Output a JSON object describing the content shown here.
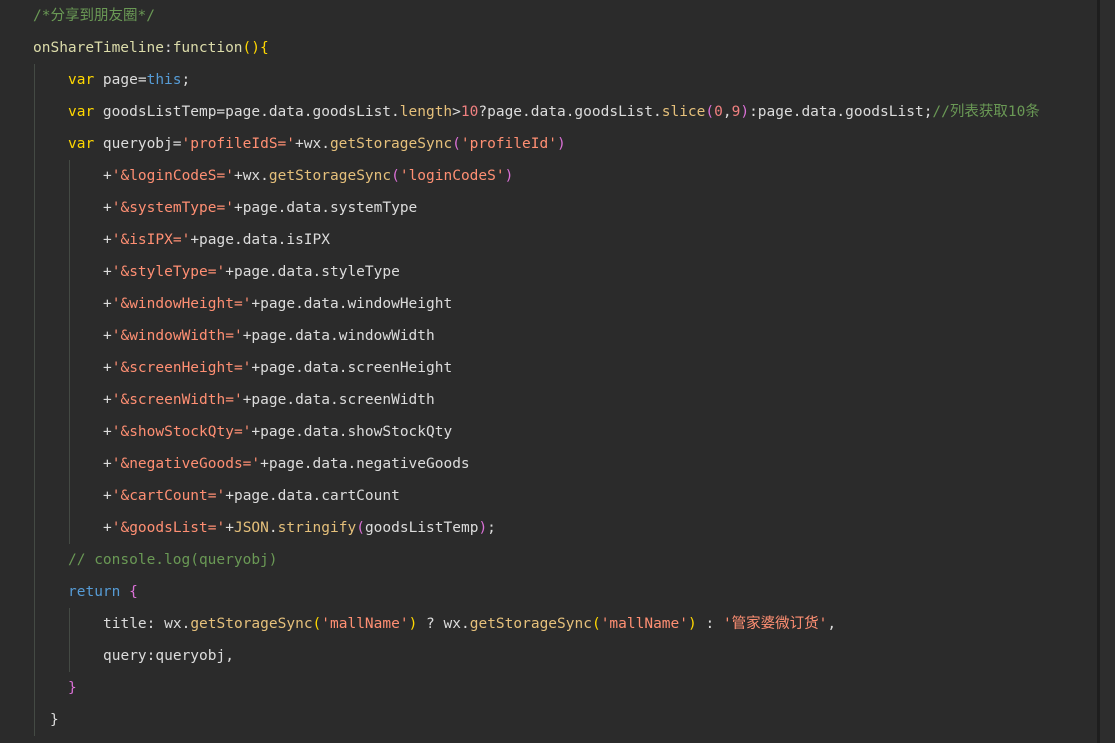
{
  "colors": {
    "background": "#2b2b2b",
    "comment": "#6a9955",
    "keyword": "#ffd700",
    "string": "#ff8f73",
    "number": "#f08080",
    "method": "#e5c07b",
    "text": "#dcdcdc"
  },
  "code": {
    "lines": [
      {
        "tokens": [
          {
            "t": "/*分享到朋友圈*/",
            "c": "cm"
          }
        ]
      },
      {
        "tokens": [
          {
            "t": "onShareTimeline",
            "c": "fn"
          },
          {
            "t": ":",
            "c": "op"
          },
          {
            "t": "function",
            "c": "fn"
          },
          {
            "t": "(",
            "c": "p1"
          },
          {
            "t": ")",
            "c": "p1"
          },
          {
            "t": "{",
            "c": "p1"
          }
        ]
      },
      {
        "tokens": [
          {
            "t": "var",
            "c": "kw"
          },
          {
            "t": " page",
            "c": "id"
          },
          {
            "t": "=",
            "c": "op"
          },
          {
            "t": "this",
            "c": "kw2"
          },
          {
            "t": ";",
            "c": "op"
          }
        ]
      },
      {
        "tokens": [
          {
            "t": "var",
            "c": "kw"
          },
          {
            "t": " goodsListTemp",
            "c": "id"
          },
          {
            "t": "=",
            "c": "op"
          },
          {
            "t": "page",
            "c": "id"
          },
          {
            "t": ".",
            "c": "op"
          },
          {
            "t": "data",
            "c": "prop"
          },
          {
            "t": ".",
            "c": "op"
          },
          {
            "t": "goodsList",
            "c": "prop"
          },
          {
            "t": ".",
            "c": "op"
          },
          {
            "t": "length",
            "c": "meth"
          },
          {
            "t": ">",
            "c": "op"
          },
          {
            "t": "10",
            "c": "num"
          },
          {
            "t": "?",
            "c": "op"
          },
          {
            "t": "page",
            "c": "id"
          },
          {
            "t": ".",
            "c": "op"
          },
          {
            "t": "data",
            "c": "prop"
          },
          {
            "t": ".",
            "c": "op"
          },
          {
            "t": "goodsList",
            "c": "prop"
          },
          {
            "t": ".",
            "c": "op"
          },
          {
            "t": "slice",
            "c": "meth"
          },
          {
            "t": "(",
            "c": "p2"
          },
          {
            "t": "0",
            "c": "num"
          },
          {
            "t": ",",
            "c": "op"
          },
          {
            "t": "9",
            "c": "num"
          },
          {
            "t": ")",
            "c": "p2"
          },
          {
            "t": ":",
            "c": "op"
          },
          {
            "t": "page",
            "c": "id"
          },
          {
            "t": ".",
            "c": "op"
          },
          {
            "t": "data",
            "c": "prop"
          },
          {
            "t": ".",
            "c": "op"
          },
          {
            "t": "goodsList",
            "c": "prop"
          },
          {
            "t": ";",
            "c": "op"
          },
          {
            "t": "//列表获取10条",
            "c": "cm"
          }
        ]
      },
      {
        "tokens": [
          {
            "t": "var",
            "c": "kw"
          },
          {
            "t": " queryobj",
            "c": "id"
          },
          {
            "t": "=",
            "c": "op"
          },
          {
            "t": "'profileIdS='",
            "c": "str"
          },
          {
            "t": "+",
            "c": "op"
          },
          {
            "t": "wx",
            "c": "id"
          },
          {
            "t": ".",
            "c": "op"
          },
          {
            "t": "getStorageSync",
            "c": "meth"
          },
          {
            "t": "(",
            "c": "p2"
          },
          {
            "t": "'profileId'",
            "c": "str"
          },
          {
            "t": ")",
            "c": "p2"
          }
        ]
      },
      {
        "tokens": [
          {
            "t": "+",
            "c": "op"
          },
          {
            "t": "'&loginCodeS='",
            "c": "str"
          },
          {
            "t": "+",
            "c": "op"
          },
          {
            "t": "wx",
            "c": "id"
          },
          {
            "t": ".",
            "c": "op"
          },
          {
            "t": "getStorageSync",
            "c": "meth"
          },
          {
            "t": "(",
            "c": "p2"
          },
          {
            "t": "'loginCodeS'",
            "c": "str"
          },
          {
            "t": ")",
            "c": "p2"
          }
        ]
      },
      {
        "tokens": [
          {
            "t": "+",
            "c": "op"
          },
          {
            "t": "'&systemType='",
            "c": "str"
          },
          {
            "t": "+",
            "c": "op"
          },
          {
            "t": "page.data.systemType",
            "c": "id"
          }
        ]
      },
      {
        "tokens": [
          {
            "t": "+",
            "c": "op"
          },
          {
            "t": "'&isIPX='",
            "c": "str"
          },
          {
            "t": "+",
            "c": "op"
          },
          {
            "t": "page.data.isIPX",
            "c": "id"
          }
        ]
      },
      {
        "tokens": [
          {
            "t": "+",
            "c": "op"
          },
          {
            "t": "'&styleType='",
            "c": "str"
          },
          {
            "t": "+",
            "c": "op"
          },
          {
            "t": "page.data.styleType",
            "c": "id"
          }
        ]
      },
      {
        "tokens": [
          {
            "t": "+",
            "c": "op"
          },
          {
            "t": "'&windowHeight='",
            "c": "str"
          },
          {
            "t": "+",
            "c": "op"
          },
          {
            "t": "page.data.windowHeight",
            "c": "id"
          }
        ]
      },
      {
        "tokens": [
          {
            "t": "+",
            "c": "op"
          },
          {
            "t": "'&windowWidth='",
            "c": "str"
          },
          {
            "t": "+",
            "c": "op"
          },
          {
            "t": "page.data.windowWidth",
            "c": "id"
          }
        ]
      },
      {
        "tokens": [
          {
            "t": "+",
            "c": "op"
          },
          {
            "t": "'&screenHeight='",
            "c": "str"
          },
          {
            "t": "+",
            "c": "op"
          },
          {
            "t": "page.data.screenHeight",
            "c": "id"
          }
        ]
      },
      {
        "tokens": [
          {
            "t": "+",
            "c": "op"
          },
          {
            "t": "'&screenWidth='",
            "c": "str"
          },
          {
            "t": "+",
            "c": "op"
          },
          {
            "t": "page.data.screenWidth",
            "c": "id"
          }
        ]
      },
      {
        "tokens": [
          {
            "t": "+",
            "c": "op"
          },
          {
            "t": "'&showStockQty='",
            "c": "str"
          },
          {
            "t": "+",
            "c": "op"
          },
          {
            "t": "page.data.showStockQty",
            "c": "id"
          }
        ]
      },
      {
        "tokens": [
          {
            "t": "+",
            "c": "op"
          },
          {
            "t": "'&negativeGoods='",
            "c": "str"
          },
          {
            "t": "+",
            "c": "op"
          },
          {
            "t": "page.data.negativeGoods",
            "c": "id"
          }
        ]
      },
      {
        "tokens": [
          {
            "t": "+",
            "c": "op"
          },
          {
            "t": "'&cartCount='",
            "c": "str"
          },
          {
            "t": "+",
            "c": "op"
          },
          {
            "t": "page.data.cartCount",
            "c": "id"
          }
        ]
      },
      {
        "tokens": [
          {
            "t": "+",
            "c": "op"
          },
          {
            "t": "'&goodsList='",
            "c": "str"
          },
          {
            "t": "+",
            "c": "op"
          },
          {
            "t": "JSON",
            "c": "obj"
          },
          {
            "t": ".",
            "c": "op"
          },
          {
            "t": "stringify",
            "c": "meth"
          },
          {
            "t": "(",
            "c": "p2"
          },
          {
            "t": "goodsListTemp",
            "c": "id"
          },
          {
            "t": ")",
            "c": "p2"
          },
          {
            "t": ";",
            "c": "op"
          }
        ]
      },
      {
        "tokens": [
          {
            "t": "// console.log(queryobj)",
            "c": "cm"
          }
        ]
      },
      {
        "tokens": [
          {
            "t": "return",
            "c": "ret"
          },
          {
            "t": " ",
            "c": "op"
          },
          {
            "t": "{",
            "c": "p2"
          }
        ]
      },
      {
        "tokens": [
          {
            "t": "title",
            "c": "key"
          },
          {
            "t": ": ",
            "c": "op"
          },
          {
            "t": "wx",
            "c": "id"
          },
          {
            "t": ".",
            "c": "op"
          },
          {
            "t": "getStorageSync",
            "c": "meth"
          },
          {
            "t": "(",
            "c": "p1"
          },
          {
            "t": "'mallName'",
            "c": "str"
          },
          {
            "t": ")",
            "c": "p1"
          },
          {
            "t": " ? ",
            "c": "op"
          },
          {
            "t": "wx",
            "c": "id"
          },
          {
            "t": ".",
            "c": "op"
          },
          {
            "t": "getStorageSync",
            "c": "meth"
          },
          {
            "t": "(",
            "c": "p1"
          },
          {
            "t": "'mallName'",
            "c": "str"
          },
          {
            "t": ")",
            "c": "p1"
          },
          {
            "t": " : ",
            "c": "op"
          },
          {
            "t": "'管家婆微订货'",
            "c": "str"
          },
          {
            "t": ",",
            "c": "op"
          }
        ]
      },
      {
        "tokens": [
          {
            "t": "query",
            "c": "key"
          },
          {
            "t": ":",
            "c": "op"
          },
          {
            "t": "queryobj",
            "c": "id"
          },
          {
            "t": ",",
            "c": "op"
          }
        ]
      },
      {
        "tokens": [
          {
            "t": "}",
            "c": "p2"
          }
        ]
      },
      {
        "tokens": [
          {
            "t": "}",
            "c": "op"
          }
        ]
      }
    ]
  }
}
